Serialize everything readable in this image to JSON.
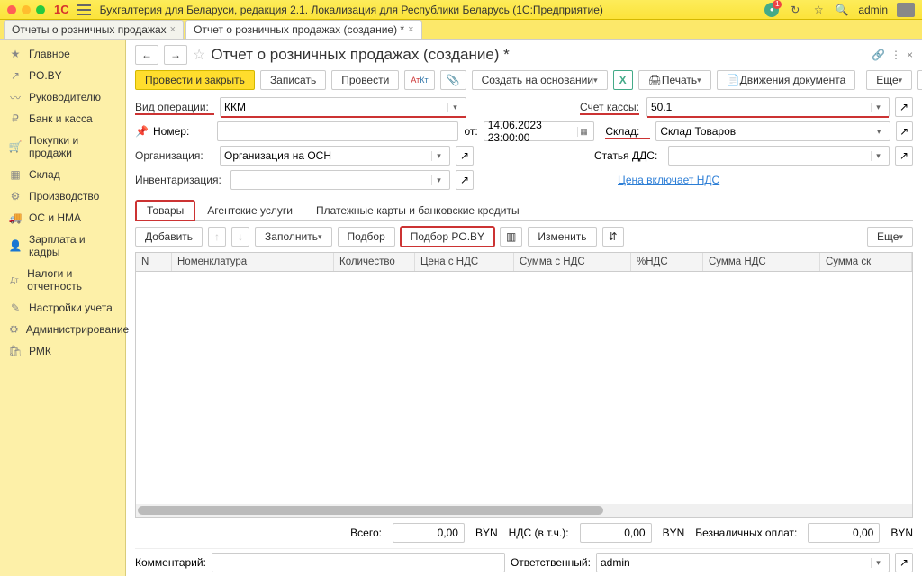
{
  "titlebar": {
    "app_title": "Бухгалтерия для Беларуси, редакция 2.1. Локализация для Республики Беларусь   (1С:Предприятие)",
    "user": "admin"
  },
  "tabs": [
    {
      "label": "Отчеты о розничных продажах"
    },
    {
      "label": "Отчет о розничных продажах (создание) *"
    }
  ],
  "sidebar": {
    "items": [
      {
        "label": "Главное",
        "icon": "★"
      },
      {
        "label": "PO.BY",
        "icon": "↗"
      },
      {
        "label": "Руководителю",
        "icon": "〰"
      },
      {
        "label": "Банк и касса",
        "icon": "₽"
      },
      {
        "label": "Покупки и продажи",
        "icon": "🛒"
      },
      {
        "label": "Склад",
        "icon": "▦"
      },
      {
        "label": "Производство",
        "icon": "⚙"
      },
      {
        "label": "ОС и НМА",
        "icon": "🚚"
      },
      {
        "label": "Зарплата и кадры",
        "icon": "👤"
      },
      {
        "label": "Налоги и отчетность",
        "icon": "Дт"
      },
      {
        "label": "Настройки учета",
        "icon": "✎"
      },
      {
        "label": "Администрирование",
        "icon": "⚙"
      },
      {
        "label": "РМК",
        "icon": "🛍"
      }
    ]
  },
  "page": {
    "title": "Отчет о розничных продажах (создание) *",
    "toolbar": {
      "post_close": "Провести и закрыть",
      "write": "Записать",
      "post": "Провести",
      "create_based": "Создать на основании",
      "print": "Печать",
      "movements": "Движения документа",
      "more": "Еще",
      "help": "?"
    },
    "fields": {
      "op_type_label": "Вид операции:",
      "op_type_value": "ККМ",
      "number_label": "Номер:",
      "number_value": "",
      "from_label": "от:",
      "from_value": "14.06.2023 23:00:00",
      "cash_acc_label": "Счет кассы:",
      "cash_acc_value": "50.1",
      "warehouse_label": "Склад:",
      "warehouse_value": "Склад Товаров",
      "org_label": "Организация:",
      "org_value": "Организация на ОСН",
      "dds_label": "Статья ДДС:",
      "dds_value": "",
      "inventory_label": "Инвентаризация:",
      "inventory_value": "",
      "price_vat_link": "Цена включает НДС"
    },
    "form_tabs": [
      {
        "label": "Товары"
      },
      {
        "label": "Агентские услуги"
      },
      {
        "label": "Платежные карты и банковские кредиты"
      }
    ],
    "table_toolbar": {
      "add": "Добавить",
      "fill": "Заполнить",
      "pick": "Подбор",
      "pick_poby": "Подбор PO.BY",
      "change": "Изменить",
      "more": "Еще"
    },
    "table": {
      "columns": [
        "N",
        "Номенклатура",
        "Количество",
        "Цена с НДС",
        "Сумма с НДС",
        "%НДС",
        "Сумма НДС",
        "Сумма ск"
      ]
    },
    "totals": {
      "total_label": "Всего:",
      "total_value": "0,00",
      "currency": "BYN",
      "vat_label": "НДС (в т.ч.):",
      "vat_value": "0,00",
      "cashless_label": "Безналичных оплат:",
      "cashless_value": "0,00"
    },
    "footer": {
      "comment_label": "Комментарий:",
      "comment_value": "",
      "responsible_label": "Ответственный:",
      "responsible_value": "admin"
    }
  }
}
